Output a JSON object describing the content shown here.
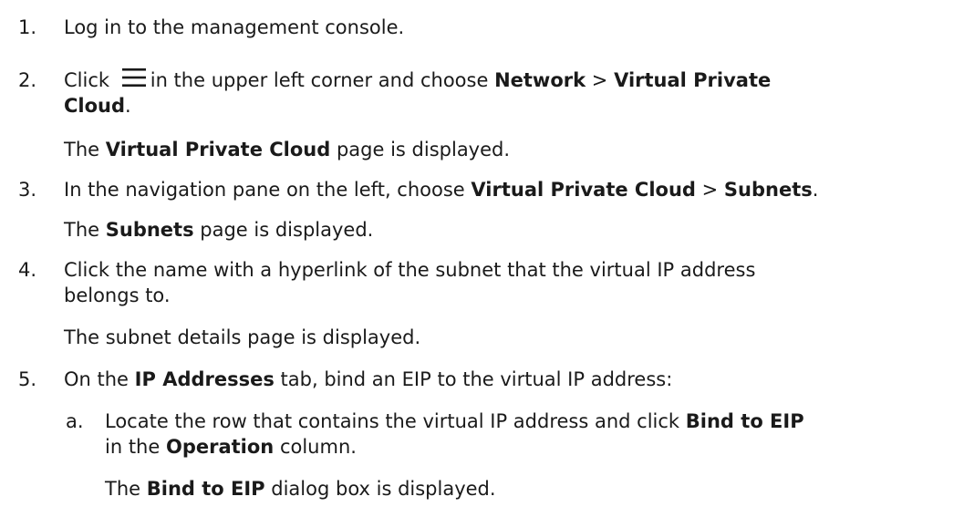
{
  "steps": [
    {
      "number": "1.",
      "text": "Log in to the management console."
    },
    {
      "number": "2.",
      "pre": "Click",
      "icon": "menu-icon",
      "mid": "in the upper left corner and choose",
      "b1": "Network",
      "sep": ">",
      "b2": "Virtual Private",
      "b2cont": "Cloud",
      "end": ".",
      "result_b": "Virtual Private Cloud",
      "result_rest": "page is displayed."
    },
    {
      "number": "3.",
      "pre": "In the navigation pane on the left, choose",
      "b1": "Virtual Private Cloud",
      "sep": ">",
      "b2": "Subnets",
      "end": ".",
      "result_b": "Subnets",
      "result_rest": "page is displayed."
    },
    {
      "number": "4.",
      "line1": "Click the name with a hyperlink of the subnet that the virtual IP address",
      "line2": "belongs to.",
      "result": "The subnet details page is displayed."
    },
    {
      "number": "5.",
      "pre": "On the",
      "b1": "IP Addresses",
      "rest": "tab, bind an EIP to the virtual IP address:",
      "sub": {
        "letter": "a.",
        "line1_pre": "Locate the row that contains the virtual IP address and click",
        "line1_b": "Bind to EIP",
        "line2_pre": "in the",
        "line2_b": "Operation",
        "line2_rest": "column.",
        "result_pre": "The",
        "result_b": "Bind to EIP",
        "result_rest": "dialog box is displayed."
      }
    }
  ],
  "result_prefix": "The"
}
